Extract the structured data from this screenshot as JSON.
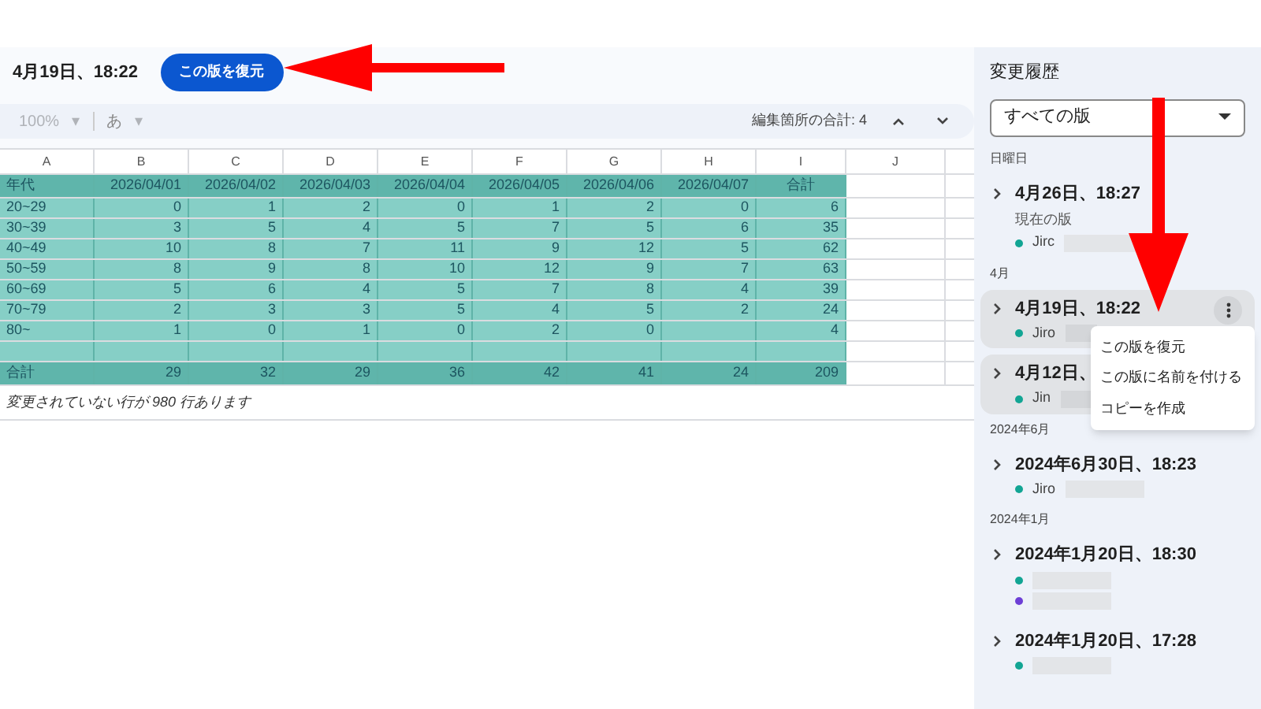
{
  "header": {
    "version_title": "4月19日、18:22",
    "restore_button": "この版を復元"
  },
  "toolbar": {
    "zoom": "100%",
    "zoom_caret": "▾",
    "input_mode": "あ",
    "input_caret": "▾",
    "edit_count": "編集箇所の合計: 4"
  },
  "sheet": {
    "columns": [
      "A",
      "B",
      "C",
      "D",
      "E",
      "F",
      "G",
      "H",
      "I",
      "J"
    ],
    "rows": [
      [
        "年代",
        "2026/04/01",
        "2026/04/02",
        "2026/04/03",
        "2026/04/04",
        "2026/04/05",
        "2026/04/06",
        "2026/04/07",
        "合計"
      ],
      [
        "20~29",
        "0",
        "1",
        "2",
        "0",
        "1",
        "2",
        "0",
        "6"
      ],
      [
        "30~39",
        "3",
        "5",
        "4",
        "5",
        "7",
        "5",
        "6",
        "35"
      ],
      [
        "40~49",
        "10",
        "8",
        "7",
        "11",
        "9",
        "12",
        "5",
        "62"
      ],
      [
        "50~59",
        "8",
        "9",
        "8",
        "10",
        "12",
        "9",
        "7",
        "63"
      ],
      [
        "60~69",
        "5",
        "6",
        "4",
        "5",
        "7",
        "8",
        "4",
        "39"
      ],
      [
        "70~79",
        "2",
        "3",
        "3",
        "5",
        "4",
        "5",
        "2",
        "24"
      ],
      [
        "80~",
        "1",
        "0",
        "1",
        "0",
        "2",
        "0",
        "",
        "4"
      ],
      [
        "",
        "",
        "",
        "",
        "",
        "",
        "",
        "",
        ""
      ],
      [
        "合計",
        "29",
        "32",
        "29",
        "36",
        "42",
        "41",
        "24",
        "209"
      ]
    ],
    "unchanged_note": "変更されていない行が 980 行あります"
  },
  "history": {
    "title": "変更履歴",
    "filter": "すべての版",
    "groups": [
      {
        "label": "日曜日",
        "versions": [
          {
            "title": "4月26日、18:27",
            "subtitle": "現在の版",
            "selected": false,
            "users": [
              {
                "name": "Jirc",
                "color": "#12a594"
              }
            ]
          }
        ]
      },
      {
        "label": "4月",
        "versions": [
          {
            "title": "4月19日、18:22",
            "selected": true,
            "menu_open": true,
            "users": [
              {
                "name": "Jiro",
                "color": "#12a594"
              }
            ]
          },
          {
            "title": "4月12日、",
            "selected": true,
            "menu_open": false,
            "users": [
              {
                "name": "Jin",
                "color": "#12a594"
              }
            ]
          }
        ]
      },
      {
        "label": "2024年6月",
        "versions": [
          {
            "title": "2024年6月30日、18:23",
            "selected": false,
            "users": [
              {
                "name": "Jiro",
                "color": "#12a594"
              }
            ]
          }
        ]
      },
      {
        "label": "2024年1月",
        "versions": [
          {
            "title": "2024年1月20日、18:30",
            "selected": false,
            "users": [
              {
                "color": "#12a594"
              },
              {
                "color": "#6d3fd6"
              }
            ]
          },
          {
            "title": "2024年1月20日、17:28",
            "selected": false,
            "users": [
              {
                "color": "#12a594"
              }
            ]
          }
        ]
      }
    ],
    "menu": [
      "この版を復元",
      "この版に名前を付ける",
      "コピーを作成"
    ]
  }
}
